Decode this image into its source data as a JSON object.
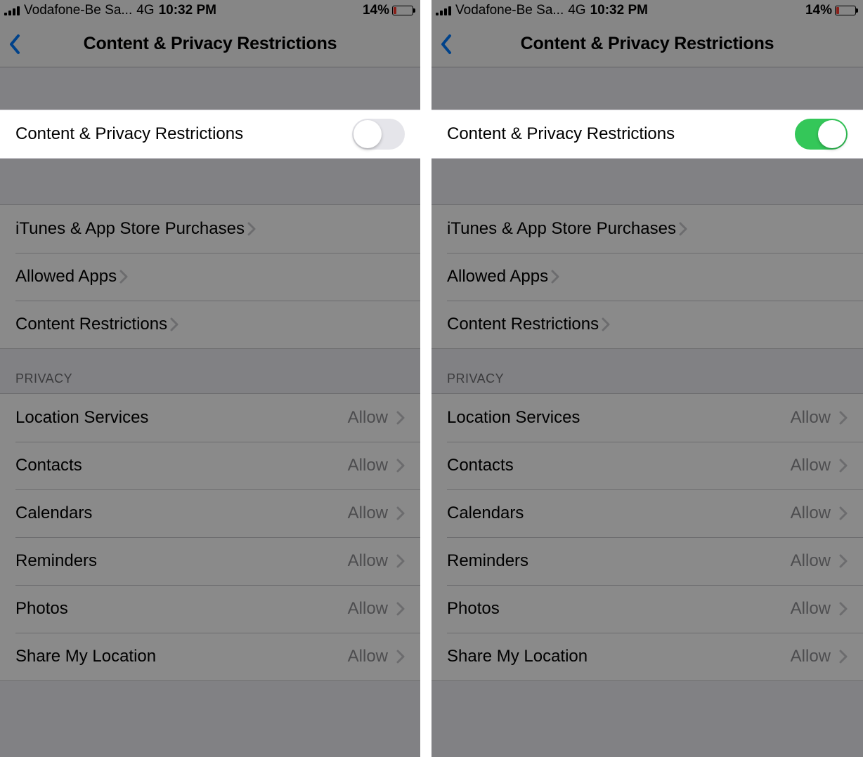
{
  "status": {
    "carrier": "Vodafone-Be Sa...",
    "network": "4G",
    "time": "10:32 PM",
    "battery_pct": "14%"
  },
  "nav": {
    "title": "Content & Privacy Restrictions"
  },
  "toggle": {
    "label": "Content & Privacy Restrictions"
  },
  "left": {
    "toggle_on": false
  },
  "right": {
    "toggle_on": true
  },
  "group1": [
    {
      "label": "iTunes & App Store Purchases"
    },
    {
      "label": "Allowed Apps"
    },
    {
      "label": "Content Restrictions"
    }
  ],
  "privacy_header": "Privacy",
  "privacy": [
    {
      "label": "Location Services",
      "value": "Allow"
    },
    {
      "label": "Contacts",
      "value": "Allow"
    },
    {
      "label": "Calendars",
      "value": "Allow"
    },
    {
      "label": "Reminders",
      "value": "Allow"
    },
    {
      "label": "Photos",
      "value": "Allow"
    },
    {
      "label": "Share My Location",
      "value": "Allow"
    }
  ]
}
